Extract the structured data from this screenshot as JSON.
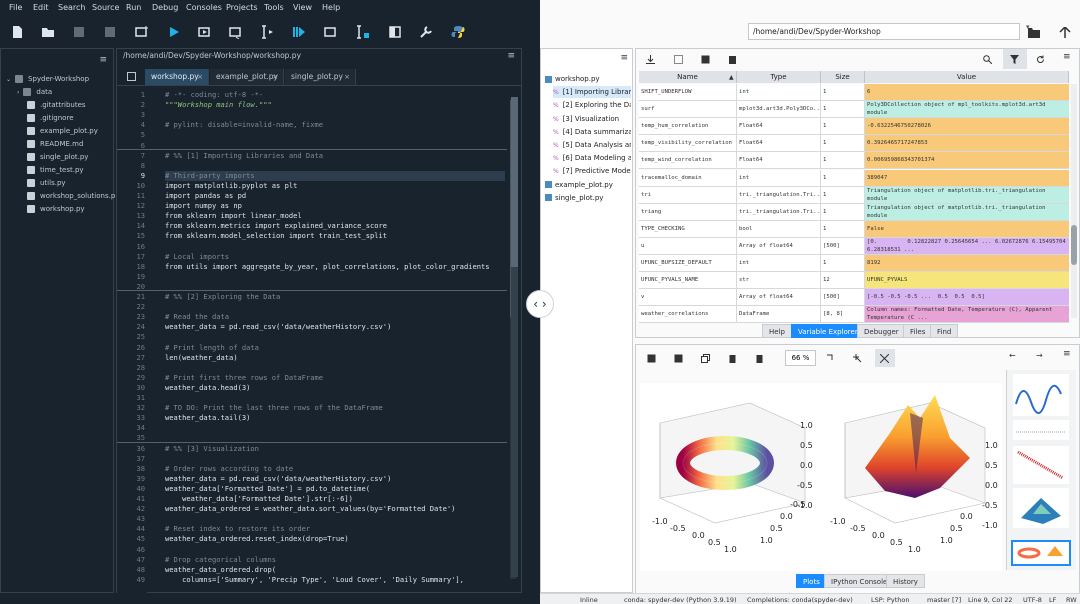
{
  "menu": [
    "File",
    "Edit",
    "Search",
    "Source",
    "Run",
    "Debug",
    "Consoles",
    "Projects",
    "Tools",
    "View",
    "Help"
  ],
  "path_left": "/home/andi/Dev/Spyder-Workshop/workshop.py",
  "path_right": "/home/andi/Dev/Spyder-Workshop",
  "project": {
    "root": "Spyder-Workshop",
    "items": [
      {
        "name": "data",
        "type": "folder"
      },
      {
        "name": ".gitattributes",
        "type": "file"
      },
      {
        "name": ".gitignore",
        "type": "file"
      },
      {
        "name": "example_plot.py",
        "type": "py"
      },
      {
        "name": "README.md",
        "type": "file"
      },
      {
        "name": "single_plot.py",
        "type": "py"
      },
      {
        "name": "time_test.py",
        "type": "py"
      },
      {
        "name": "utils.py",
        "type": "py"
      },
      {
        "name": "workshop_solutions.p",
        "type": "py"
      },
      {
        "name": "workshop.py",
        "type": "py"
      }
    ]
  },
  "editor_tabs": [
    {
      "label": "workshop.py",
      "active": true
    },
    {
      "label": "example_plot.py",
      "active": false
    },
    {
      "label": "single_plot.py",
      "active": false
    }
  ],
  "code": [
    {
      "n": "1",
      "t": "# -*- coding: utf-8 -*-",
      "c": "cm"
    },
    {
      "n": "2",
      "t": "\"\"\"Workshop main flow.\"\"\"",
      "c": "st"
    },
    {
      "n": "3",
      "t": "",
      "c": ""
    },
    {
      "n": "4",
      "t": "# pylint: disable=invalid-name, fixme",
      "c": "cm"
    },
    {
      "n": "5",
      "t": "",
      "c": ""
    },
    {
      "n": "6",
      "t": "",
      "c": ""
    },
    {
      "n": "7",
      "t": "# %% [1] Importing Libraries and Data",
      "c": "cm"
    },
    {
      "n": "8",
      "t": "",
      "c": ""
    },
    {
      "n": "9",
      "t": "# Third-party imports",
      "c": "cm",
      "hl": true
    },
    {
      "n": "10",
      "t": "import matplotlib.pyplot as plt",
      "c": ""
    },
    {
      "n": "11",
      "t": "import pandas as pd",
      "c": ""
    },
    {
      "n": "12",
      "t": "import numpy as np",
      "c": ""
    },
    {
      "n": "13",
      "t": "from sklearn import linear_model",
      "c": ""
    },
    {
      "n": "14",
      "t": "from sklearn.metrics import explained_variance_score",
      "c": ""
    },
    {
      "n": "15",
      "t": "from sklearn.model_selection import train_test_split",
      "c": ""
    },
    {
      "n": "16",
      "t": "",
      "c": ""
    },
    {
      "n": "17",
      "t": "# Local imports",
      "c": "cm"
    },
    {
      "n": "18",
      "t": "from utils import aggregate_by_year, plot_correlations, plot_color_gradients",
      "c": ""
    },
    {
      "n": "19",
      "t": "",
      "c": ""
    },
    {
      "n": "20",
      "t": "",
      "c": ""
    },
    {
      "n": "21",
      "t": "# %% [2] Exploring the Data",
      "c": "cm"
    },
    {
      "n": "22",
      "t": "",
      "c": ""
    },
    {
      "n": "23",
      "t": "# Read the data",
      "c": "cm"
    },
    {
      "n": "24",
      "t": "weather_data = pd.read_csv('data/weatherHistory.csv')",
      "c": ""
    },
    {
      "n": "25",
      "t": "",
      "c": ""
    },
    {
      "n": "26",
      "t": "# Print length of data",
      "c": "cm"
    },
    {
      "n": "27",
      "t": "len(weather_data)",
      "c": ""
    },
    {
      "n": "28",
      "t": "",
      "c": ""
    },
    {
      "n": "29",
      "t": "# Print first three rows of DataFrame",
      "c": "cm"
    },
    {
      "n": "30",
      "t": "weather_data.head(3)",
      "c": ""
    },
    {
      "n": "31",
      "t": "",
      "c": ""
    },
    {
      "n": "32",
      "t": "# TO DO: Print the last three rows of the DataFrame",
      "c": "cm"
    },
    {
      "n": "33",
      "t": "weather_data.tail(3)",
      "c": ""
    },
    {
      "n": "34",
      "t": "",
      "c": ""
    },
    {
      "n": "35",
      "t": "",
      "c": ""
    },
    {
      "n": "36",
      "t": "# %% [3] Visualization",
      "c": "cm"
    },
    {
      "n": "37",
      "t": "",
      "c": ""
    },
    {
      "n": "38",
      "t": "# Order rows according to date",
      "c": "cm"
    },
    {
      "n": "39",
      "t": "weather_data = pd.read_csv('data/weatherHistory.csv')",
      "c": ""
    },
    {
      "n": "40",
      "t": "weather_data['Formatted Date'] = pd.to_datetime(",
      "c": ""
    },
    {
      "n": "41",
      "t": "    weather_data['Formatted Date'].str[:-6])",
      "c": ""
    },
    {
      "n": "42",
      "t": "weather_data_ordered = weather_data.sort_values(by='Formatted Date')",
      "c": ""
    },
    {
      "n": "43",
      "t": "",
      "c": ""
    },
    {
      "n": "44",
      "t": "# Reset index to restore its order",
      "c": "cm"
    },
    {
      "n": "45",
      "t": "weather_data_ordered.reset_index(drop=True)",
      "c": ""
    },
    {
      "n": "46",
      "t": "",
      "c": ""
    },
    {
      "n": "47",
      "t": "# Drop categorical columns",
      "c": "cm"
    },
    {
      "n": "48",
      "t": "weather_data_ordered.drop(",
      "c": ""
    },
    {
      "n": "49",
      "t": "    columns=['Summary', 'Precip Type', 'Loud Cover', 'Daily Summary'],",
      "c": ""
    }
  ],
  "outline": [
    {
      "label": "workshop.py",
      "indent": 0
    },
    {
      "label": "[1] Importing Librar",
      "indent": 1,
      "sel": true
    },
    {
      "label": "[2] Exploring the Da",
      "indent": 1
    },
    {
      "label": "[3] Visualization",
      "indent": 1
    },
    {
      "label": "[4] Data summariza",
      "indent": 1
    },
    {
      "label": "[5] Data Analysis and",
      "indent": 1
    },
    {
      "label": "[6] Data Modeling a",
      "indent": 1
    },
    {
      "label": "[7] Predictive Model",
      "indent": 1
    },
    {
      "label": "example_plot.py",
      "indent": 0
    },
    {
      "label": "single_plot.py",
      "indent": 0
    }
  ],
  "var_headers": [
    "Name",
    "Type",
    "Size",
    "Value"
  ],
  "variables": [
    {
      "name": "SHIFT_UNDERFLOW",
      "type": "int",
      "size": "1",
      "value": "6",
      "color": "#f9c97a"
    },
    {
      "name": "surf",
      "type": "mplot3d.art3d.Poly3DCo...",
      "size": "1",
      "value": "Poly3DCollection object of mpl_toolkits.mplot3d.art3d module",
      "color": "#bdeee3"
    },
    {
      "name": "temp_hum_correlation",
      "type": "Float64",
      "size": "1",
      "value": "-0.6322546750278026",
      "color": "#f9c97a"
    },
    {
      "name": "temp_visibility_correlation",
      "type": "Float64",
      "size": "1",
      "value": "0.3926465717247853",
      "color": "#f9c97a"
    },
    {
      "name": "temp_wind_correlation",
      "type": "Float64",
      "size": "1",
      "value": "0.006959868343701374",
      "color": "#f9c97a"
    },
    {
      "name": "tracemalloc_domain",
      "type": "int",
      "size": "1",
      "value": "389047",
      "color": "#f9c97a"
    },
    {
      "name": "tri",
      "type": "tri._triangulation.Tri...",
      "size": "1",
      "value": "Triangulation object of matplotlib.tri._triangulation module",
      "color": "#bdeee3"
    },
    {
      "name": "triang",
      "type": "tri._triangulation.Tri...",
      "size": "1",
      "value": "Triangulation object of matplotlib.tri._triangulation module",
      "color": "#bdeee3"
    },
    {
      "name": "TYPE_CHECKING",
      "type": "bool",
      "size": "1",
      "value": "False",
      "color": "#f9c97a"
    },
    {
      "name": "u",
      "type": "Array of float64",
      "size": "[500]",
      "value": "[0.         0.12822827 0.25645654 ... 6.02672876 6.15495704 6.28318531 ...",
      "color": "#d8b4f2"
    },
    {
      "name": "UFUNC_BUFSIZE_DEFAULT",
      "type": "int",
      "size": "1",
      "value": "8192",
      "color": "#f9c97a"
    },
    {
      "name": "UFUNC_PYVALS_NAME",
      "type": "str",
      "size": "12",
      "value": "UFUNC_PYVALS",
      "color": "#f5e57a"
    },
    {
      "name": "v",
      "type": "Array of float64",
      "size": "[500]",
      "value": "[-0.5 -0.5 -0.5 ...  0.5  0.5  0.5]",
      "color": "#d8b4f2"
    },
    {
      "name": "weather_correlations",
      "type": "DataFrame",
      "size": "[8, 8]",
      "value": "Column names: Formatted Date, Temperature (C), Apparent Temperature (C ...",
      "color": "#e7a3d6"
    }
  ],
  "upper_tabs": [
    "Help",
    "Variable Explorer",
    "Debugger",
    "Files",
    "Find"
  ],
  "zoom": "66 %",
  "lower_tabs": [
    "Plots",
    "IPython Console",
    "History"
  ],
  "axis_ticks": [
    "1.0",
    "0.5",
    "0.0",
    "-0.5",
    "-1.0"
  ],
  "status": {
    "inline": "Inline",
    "conda": "conda: spyder-dev (Python 3.9.19)",
    "completions": "Completions: conda(spyder-dev)",
    "lsp": "LSP: Python",
    "git": "master [7]",
    "pos": "Line 9, Col 22",
    "enc": "UTF-8",
    "eol": "LF",
    "rw": "RW"
  }
}
